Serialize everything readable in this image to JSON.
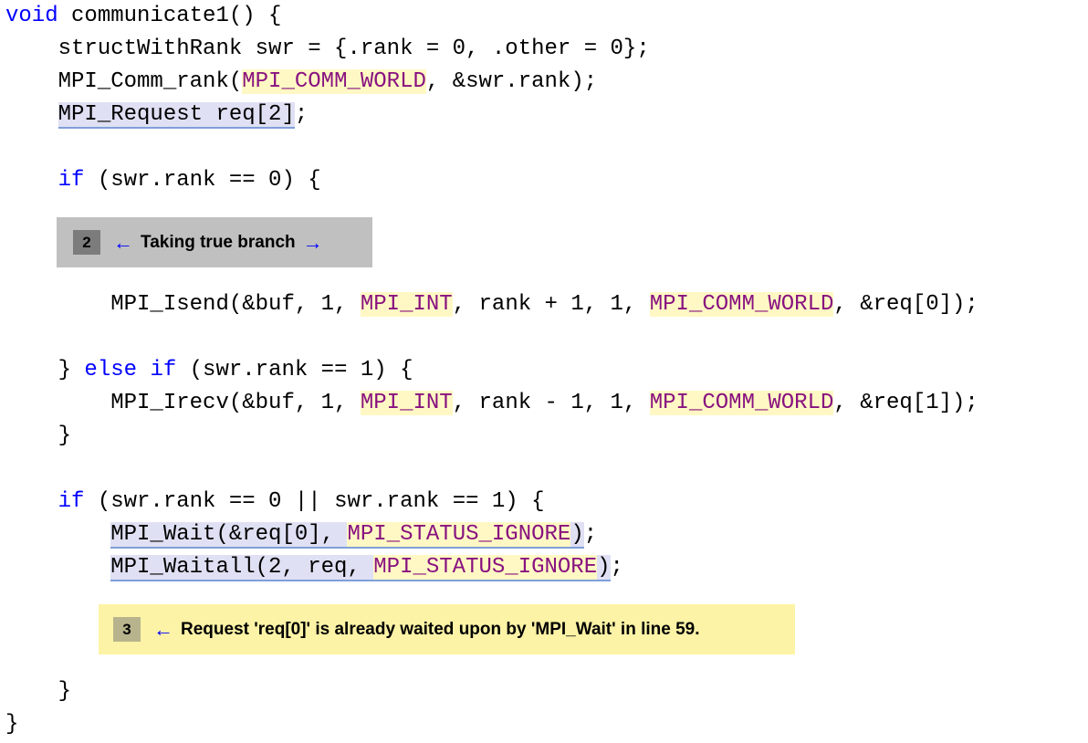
{
  "code": {
    "lines": [
      {
        "id": "l1",
        "text": "void communicate1() {"
      },
      {
        "id": "l2",
        "text": "    structWithRank swr = {.rank = 0, .other = 0};"
      },
      {
        "id": "l3",
        "text": "    MPI_Comm_rank(MPI_COMM_WORLD, &swr.rank);"
      },
      {
        "id": "l4",
        "text": "    MPI_Request req[2];"
      },
      {
        "id": "l5",
        "text": "    if (swr.rank == 0) {"
      },
      {
        "id": "l6",
        "text": "        MPI_Isend(&buf, 1, MPI_INT, rank + 1, 1, MPI_COMM_WORLD, &req[0]);"
      },
      {
        "id": "l7",
        "text": "    } else if (swr.rank == 1) {"
      },
      {
        "id": "l8",
        "text": "        MPI_Irecv(&buf, 1, MPI_INT, rank - 1, 1, MPI_COMM_WORLD, &req[1]);"
      },
      {
        "id": "l9",
        "text": "    }"
      },
      {
        "id": "l10",
        "text": "    if (swr.rank == 0 || swr.rank == 1) {"
      },
      {
        "id": "l11",
        "text": "        MPI_Wait(&req[0], MPI_STATUS_IGNORE);"
      },
      {
        "id": "l12",
        "text": "        MPI_Waitall(2, req, MPI_STATUS_IGNORE);"
      },
      {
        "id": "l13",
        "text": "    }"
      },
      {
        "id": "l14",
        "text": "}"
      }
    ]
  },
  "notes": {
    "note1": {
      "number": "2",
      "text": "Taking true branch",
      "arrow_left": "←",
      "arrow_right": "→"
    },
    "note2": {
      "number": "3",
      "text": "Request 'req[0]' is already waited upon by 'MPI_Wait' in line 59.",
      "arrow_left": "←"
    }
  },
  "colors": {
    "keyword": "#0000ff",
    "macro_text": "#881280",
    "macro_bg": "#fff8c4",
    "highlight_bg": "#e0e0f4",
    "note_gray_bg": "#c0c0c0",
    "note_yellow_bg": "#fcf3a6",
    "arrow": "#0000ff"
  }
}
